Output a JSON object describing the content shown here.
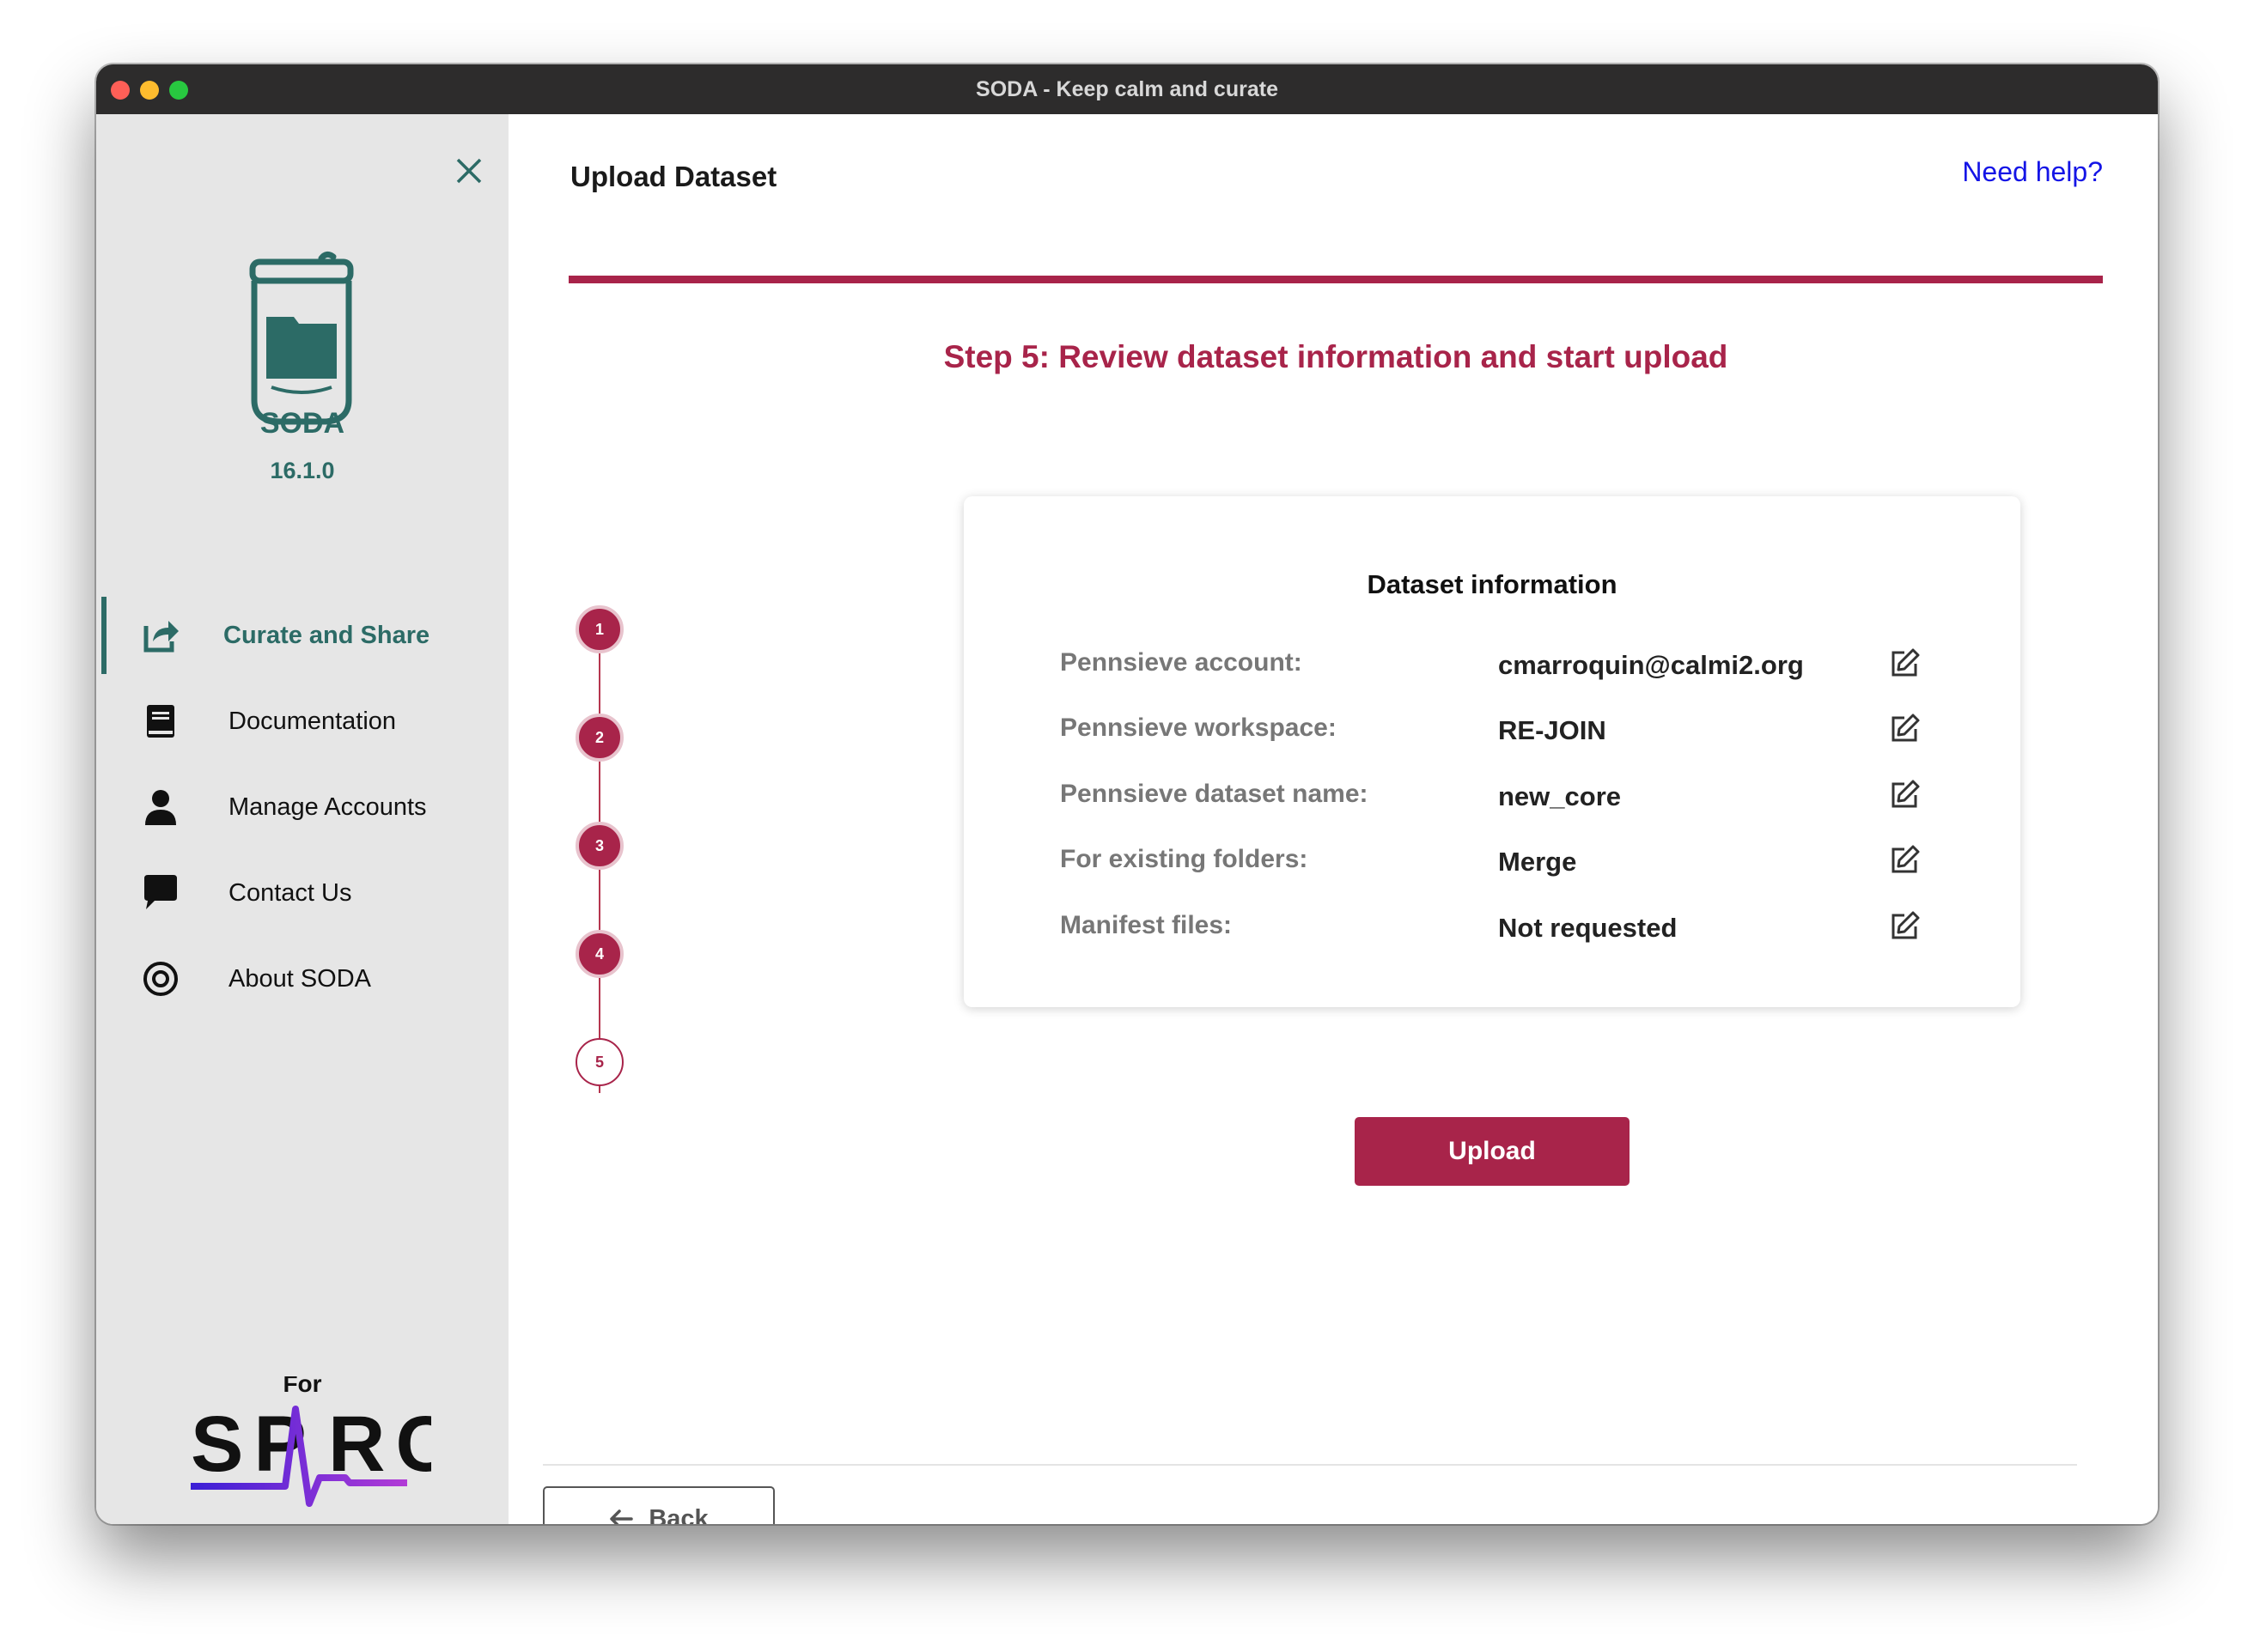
{
  "window": {
    "title": "SODA - Keep calm and curate"
  },
  "sidebar": {
    "app_name": "SODA",
    "version": "16.1.0",
    "items": [
      {
        "label": "Curate and Share",
        "icon": "share-icon",
        "active": true
      },
      {
        "label": "Documentation",
        "icon": "book-icon",
        "active": false
      },
      {
        "label": "Manage Accounts",
        "icon": "user-icon",
        "active": false
      },
      {
        "label": "Contact Us",
        "icon": "chat-icon",
        "active": false
      },
      {
        "label": "About SODA",
        "icon": "target-icon",
        "active": false
      }
    ],
    "brand": {
      "prefix": "For",
      "name": "SPARC"
    }
  },
  "header": {
    "title": "Upload Dataset",
    "help_link": "Need help?"
  },
  "step_heading": "Step 5: Review dataset information and start upload",
  "stepper": {
    "steps": [
      "1",
      "2",
      "3",
      "4",
      "5"
    ],
    "current": 5
  },
  "dataset_info": {
    "title": "Dataset information",
    "rows": [
      {
        "label": "Pennsieve account:",
        "value": "cmarroquin@calmi2.org"
      },
      {
        "label": "Pennsieve workspace:",
        "value": "RE-JOIN"
      },
      {
        "label": "Pennsieve dataset name:",
        "value": "new_core"
      },
      {
        "label": "For existing folders:",
        "value": "Merge"
      },
      {
        "label": "Manifest files:",
        "value": "Not requested"
      }
    ]
  },
  "actions": {
    "upload_label": "Upload",
    "back_label": "Back"
  },
  "colors": {
    "accent": "#a8244a",
    "brand_teal": "#2c6b66",
    "link": "#1414e6"
  }
}
